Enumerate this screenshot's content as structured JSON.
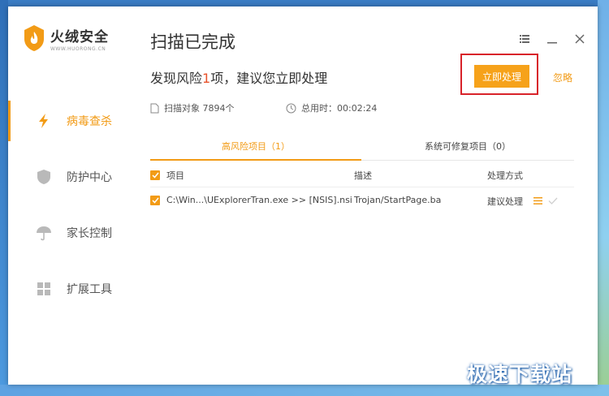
{
  "app": {
    "name": "火绒安全",
    "url_text": "WWW.HUORONG.CN",
    "brand_color": "#f29b16",
    "window_controls": [
      "menu-icon",
      "minimize-icon",
      "close-icon"
    ]
  },
  "sidebar": {
    "items": [
      {
        "label": "病毒查杀",
        "icon": "lightning-icon",
        "active": true
      },
      {
        "label": "防护中心",
        "icon": "shield-icon",
        "active": false
      },
      {
        "label": "家长控制",
        "icon": "umbrella-icon",
        "active": false
      },
      {
        "label": "扩展工具",
        "icon": "grid-icon",
        "active": false
      }
    ]
  },
  "main": {
    "title": "扫描已完成",
    "summary_prefix": "发现风险",
    "summary_count": "1",
    "summary_suffix": "项，建议您立即处理",
    "primary_button": "立即处理",
    "ignore_link": "忽略",
    "stats": {
      "scan_objects": "扫描对象 7894个",
      "total_time": "总用时：00:02:24"
    },
    "tabs": [
      {
        "label": "高风险项目（1）",
        "active": true
      },
      {
        "label": "系统可修复项目（0）",
        "active": false
      }
    ],
    "table": {
      "headers": [
        "项目",
        "描述",
        "处理方式"
      ],
      "rows": [
        {
          "checked": true,
          "item": "C:\\Win...\\UExplorerTran.exe >> [NSIS].nsi",
          "description": "Trojan/StartPage.ba",
          "action": "建议处理"
        }
      ]
    }
  },
  "watermark": "极速下载站"
}
